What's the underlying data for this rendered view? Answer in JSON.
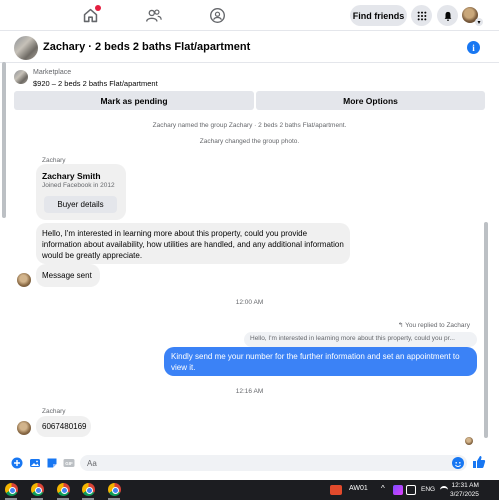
{
  "nav": {
    "find_friends_label": "Find friends"
  },
  "chat": {
    "title": "Zachary · 2 beds 2 baths Flat/apartment",
    "marketplace_label": "Marketplace",
    "marketplace_listing": "$920 – 2 beds 2 baths Flat/apartment",
    "mark_pending_label": "Mark as pending",
    "more_options_label": "More Options"
  },
  "thread": {
    "system_1": "Zachary named the group Zachary · 2 beds 2 baths Flat/apartment.",
    "system_2": "Zachary changed the group photo.",
    "sender_1": "Zachary",
    "contact_name": "Zachary Smith",
    "contact_joined": "Joined Facebook in 2012",
    "buyer_details_label": "Buyer details",
    "msg_inquiry": "Hello, I'm interested in learning more about this property, could you provide information about availability, how utilities are handled, and any additional information would be greatly appreciate.",
    "msg_sent": "Message sent",
    "time_1": "12:00 AM",
    "replied_label": "You replied to Zachary",
    "quoted_text": "Hello, I'm interested in learning more about this property, could you pr...",
    "msg_reply": "Kindly send me your number for the further information and set an appointment to view it.",
    "time_2": "12:16 AM",
    "sender_2": "Zachary",
    "msg_number": "6067480169"
  },
  "composer": {
    "placeholder": "Aa"
  },
  "taskbar": {
    "weather_label": "AW01",
    "caret": "^",
    "lang": "ENG",
    "time": "12:31 AM",
    "date": "3/27/2025"
  },
  "colors": {
    "accent": "#1877f2",
    "outgoing_bubble": "#3b82f6",
    "incoming_bubble": "#f0f0f0"
  }
}
